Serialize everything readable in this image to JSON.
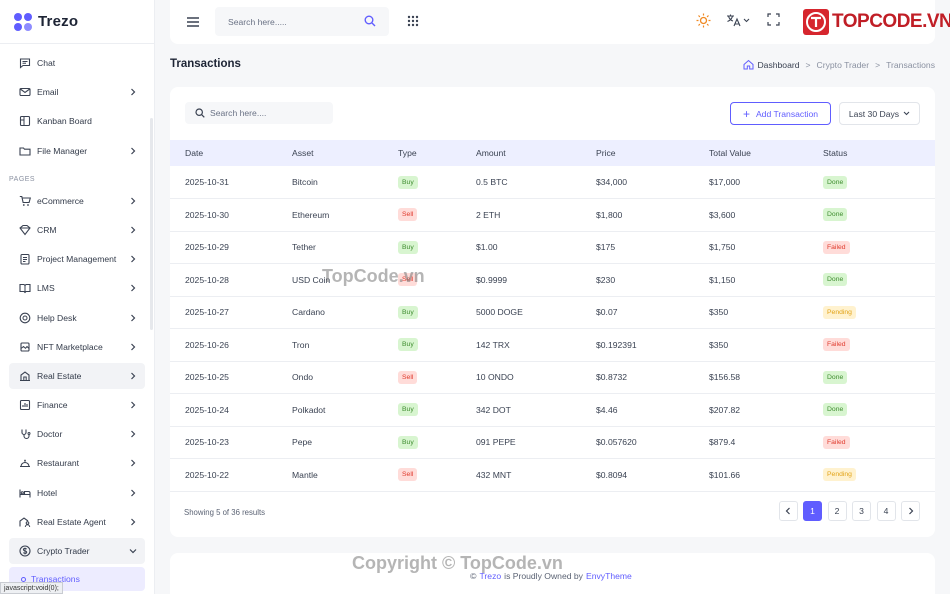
{
  "brand": {
    "name": "Trezo"
  },
  "sidebar": {
    "items_top": [
      {
        "label": "Chat",
        "icon": "chat-icon",
        "chevron": false
      },
      {
        "label": "Email",
        "icon": "email-icon",
        "chevron": true
      },
      {
        "label": "Kanban Board",
        "icon": "kanban-icon",
        "chevron": false
      },
      {
        "label": "File Manager",
        "icon": "folder-icon",
        "chevron": true
      }
    ],
    "section_pages": "PAGES",
    "items_pages": [
      {
        "label": "eCommerce",
        "icon": "cart-icon"
      },
      {
        "label": "CRM",
        "icon": "crm-icon"
      },
      {
        "label": "Project Management",
        "icon": "project-icon"
      },
      {
        "label": "LMS",
        "icon": "lms-icon"
      },
      {
        "label": "Help Desk",
        "icon": "helpdesk-icon"
      },
      {
        "label": "NFT Marketplace",
        "icon": "nft-icon"
      },
      {
        "label": "Real Estate",
        "icon": "real-estate-icon"
      },
      {
        "label": "Finance",
        "icon": "finance-icon"
      },
      {
        "label": "Doctor",
        "icon": "doctor-icon"
      },
      {
        "label": "Restaurant",
        "icon": "restaurant-icon"
      },
      {
        "label": "Hotel",
        "icon": "hotel-icon"
      },
      {
        "label": "Real Estate Agent",
        "icon": "agent-icon"
      },
      {
        "label": "Crypto Trader",
        "icon": "dollar-icon"
      }
    ],
    "sub_active": "Transactions"
  },
  "status_bar": "javascript:void(0);",
  "header": {
    "search_placeholder": "Search here.....",
    "brand_watermark": "TOPCODE.VN"
  },
  "page": {
    "title": "Transactions",
    "breadcrumb": [
      "Dashboard",
      "Crypto Trader",
      "Transactions"
    ]
  },
  "toolbar": {
    "search_placeholder": "Search here....",
    "add_label": "Add Transaction",
    "range_label": "Last 30 Days"
  },
  "table": {
    "columns": [
      "Date",
      "Asset",
      "Type",
      "Amount",
      "Price",
      "Total Value",
      "Status"
    ],
    "rows": [
      {
        "date": "2025-10-31",
        "asset": "Bitcoin",
        "type": "Buy",
        "amount": "0.5 BTC",
        "price": "$34,000",
        "total": "$17,000",
        "status": "Done"
      },
      {
        "date": "2025-10-30",
        "asset": "Ethereum",
        "type": "Sell",
        "amount": "2 ETH",
        "price": "$1,800",
        "total": "$3,600",
        "status": "Done"
      },
      {
        "date": "2025-10-29",
        "asset": "Tether",
        "type": "Buy",
        "amount": "$1.00",
        "price": "$175",
        "total": "$1,750",
        "status": "Failed"
      },
      {
        "date": "2025-10-28",
        "asset": "USD Coin",
        "type": "Sell",
        "amount": "$0.9999",
        "price": "$230",
        "total": "$1,150",
        "status": "Done"
      },
      {
        "date": "2025-10-27",
        "asset": "Cardano",
        "type": "Buy",
        "amount": "5000 DOGE",
        "price": "$0.07",
        "total": "$350",
        "status": "Pending"
      },
      {
        "date": "2025-10-26",
        "asset": "Tron",
        "type": "Buy",
        "amount": "142 TRX",
        "price": "$0.192391",
        "total": "$350",
        "status": "Failed"
      },
      {
        "date": "2025-10-25",
        "asset": "Ondo",
        "type": "Sell",
        "amount": "10 ONDO",
        "price": "$0.8732",
        "total": "$156.58",
        "status": "Done"
      },
      {
        "date": "2025-10-24",
        "asset": "Polkadot",
        "type": "Buy",
        "amount": "342 DOT",
        "price": "$4.46",
        "total": "$207.82",
        "status": "Done"
      },
      {
        "date": "2025-10-23",
        "asset": "Pepe",
        "type": "Buy",
        "amount": "091 PEPE",
        "price": "$0.057620",
        "total": "$879.4",
        "status": "Failed"
      },
      {
        "date": "2025-10-22",
        "asset": "Mantle",
        "type": "Sell",
        "amount": "432 MNT",
        "price": "$0.8094",
        "total": "$101.66",
        "status": "Pending"
      }
    ]
  },
  "pagination": {
    "summary": "Showing 5 of 36 results",
    "pages": [
      "1",
      "2",
      "3",
      "4"
    ],
    "current": "1"
  },
  "footer": {
    "copyright": "©",
    "brand": "Trezo",
    "middle": "is Proudly Owned by",
    "owner": "EnvyTheme"
  },
  "watermarks": [
    "TopCode.vn",
    "Copyright © TopCode.vn"
  ],
  "colors": {
    "accent": "#605dff",
    "buy": "#3f8d2f",
    "sell": "#e03b2e",
    "pending": "#e2a216"
  }
}
